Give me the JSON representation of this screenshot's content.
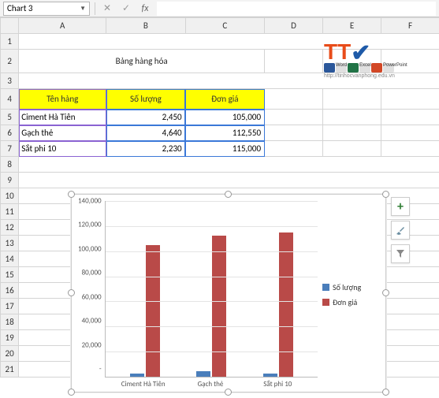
{
  "name_box": "Chart 3",
  "formula": "",
  "columns": [
    "A",
    "B",
    "C",
    "D",
    "E",
    "F"
  ],
  "rows": [
    1,
    2,
    3,
    4,
    5,
    6,
    7,
    8,
    9,
    10,
    11,
    12,
    13,
    14,
    15,
    16,
    17,
    18,
    19,
    20,
    21
  ],
  "title": "Bảng hàng hóa",
  "headers": {
    "a": "Tên hàng",
    "b": "Số lượng",
    "c": "Đơn giá"
  },
  "data": [
    {
      "name": "Ciment Hà Tiên",
      "qty": "2,450",
      "price": "105,000"
    },
    {
      "name": "Gạch thẻ",
      "qty": "4,640",
      "price": "112,550"
    },
    {
      "name": "Sắt phi 10",
      "qty": "2,230",
      "price": "115,000"
    }
  ],
  "chart_data": {
    "type": "bar",
    "categories": [
      "Ciment Hà Tiên",
      "Gạch thẻ",
      "Sắt phi 10"
    ],
    "series": [
      {
        "name": "Số lượng",
        "values": [
          2450,
          4640,
          2230
        ]
      },
      {
        "name": "Đơn giá",
        "values": [
          105000,
          112550,
          115000
        ]
      }
    ],
    "ylim": [
      0,
      140000
    ],
    "yticks": [
      "140,000",
      "120,000",
      "100,000",
      "80,000",
      "60,000",
      "40,000",
      "20,000",
      "-"
    ],
    "title": "",
    "xlabel": "",
    "ylabel": ""
  },
  "logo": {
    "url_text": "http://tinhocvanphong.edu.vn",
    "apps": [
      "Word",
      "Excel",
      "PowerPoint"
    ]
  },
  "colors": {
    "series1": "#4a7ebb",
    "series2": "#b94a48",
    "header_bg": "#ffff00"
  }
}
